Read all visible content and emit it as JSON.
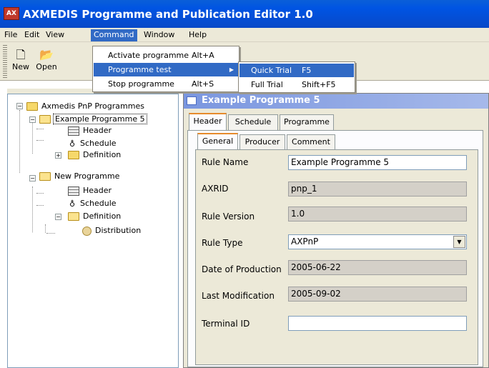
{
  "window": {
    "title": "AXMEDIS Programme and Publication Editor 1.0",
    "icon_label": "AX"
  },
  "menubar": {
    "items": [
      "File",
      "Edit",
      "View",
      "Command",
      "Window",
      "Help"
    ],
    "active": "Command"
  },
  "toolbar": {
    "new_label": "New",
    "open_label": "Open"
  },
  "command_menu": {
    "items": [
      {
        "label": "Activate programme",
        "accel": "Alt+A"
      },
      {
        "label": "Programme test",
        "accel": ""
      },
      {
        "label": "Stop programme",
        "accel": "Alt+S"
      }
    ]
  },
  "programme_test_submenu": {
    "items": [
      {
        "label": "Quick Trial",
        "accel": "F5"
      },
      {
        "label": "Full Trial",
        "accel": "Shift+F5"
      }
    ]
  },
  "tree": {
    "root": "Axmedis PnP Programmes",
    "programme1": {
      "label": "Example Programme 5",
      "header": "Header",
      "schedule": "Schedule",
      "definition": "Definition"
    },
    "programme2": {
      "label": "New Programme",
      "header": "Header",
      "schedule": "Schedule",
      "definition": "Definition",
      "distribution": "Distribution"
    }
  },
  "editor": {
    "title": "Example Programme 5",
    "tabs": [
      "Header",
      "Schedule",
      "Programme"
    ],
    "subtabs": [
      "General",
      "Producer",
      "Comment"
    ],
    "fields": {
      "rule_name_label": "Rule Name",
      "rule_name_value": "Example Programme 5",
      "axrid_label": "AXRID",
      "axrid_value": "pnp_1",
      "rule_version_label": "Rule Version",
      "rule_version_value": "1.0",
      "rule_type_label": "Rule Type",
      "rule_type_value": "AXPnP",
      "date_of_production_label": "Date of Production",
      "date_of_production_value": "2005-06-22",
      "last_modification_label": "Last Modification",
      "last_modification_value": "2005-09-02",
      "terminal_id_label": "Terminal ID",
      "terminal_id_value": ""
    }
  },
  "colors": {
    "titlebar": "#0054e3",
    "menu_highlight": "#316ac5",
    "panel_bg": "#ece9d8",
    "active_tab_accent": "#e68b2c"
  }
}
